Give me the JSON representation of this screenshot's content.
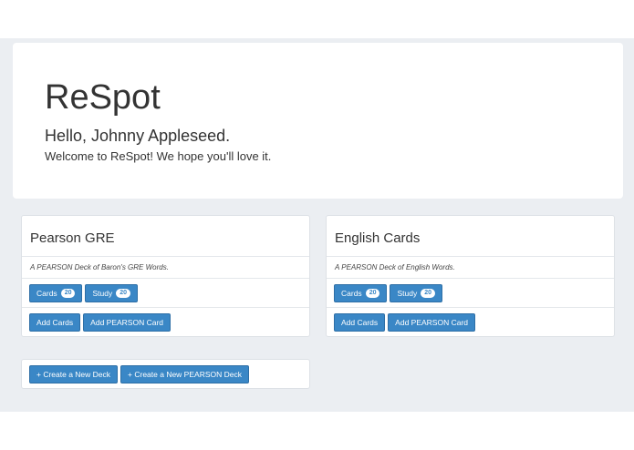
{
  "jumbotron": {
    "title": "ReSpot",
    "greeting": "Hello, Johnny Appleseed.",
    "welcome": "Welcome to ReSpot! We hope you'll love it."
  },
  "decks": [
    {
      "title": "Pearson GRE",
      "description": "A PEARSON Deck of Baron's GRE Words.",
      "cards_label": "Cards",
      "cards_count": "20",
      "study_label": "Study",
      "study_count": "20",
      "add_cards_label": "Add Cards",
      "add_pearson_label": "Add PEARSON Card"
    },
    {
      "title": "English Cards",
      "description": "A PEARSON Deck of English Words.",
      "cards_label": "Cards",
      "cards_count": "20",
      "study_label": "Study",
      "study_count": "20",
      "add_cards_label": "Add Cards",
      "add_pearson_label": "Add PEARSON Card"
    }
  ],
  "create": {
    "new_deck_label": "+ Create a New Deck",
    "new_pearson_deck_label": "+ Create a New PEARSON Deck"
  },
  "colors": {
    "primary": "#3a87c6",
    "page_background": "#ebeef2"
  }
}
